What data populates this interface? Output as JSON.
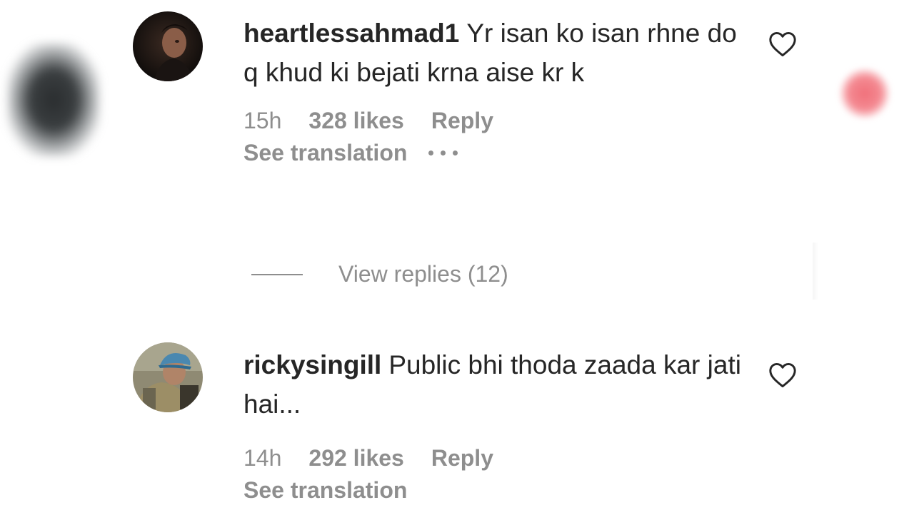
{
  "comments": [
    {
      "username": "heartlessahmad1",
      "text": "Yr isan ko isan rhne do q khud ki bejati krna aise kr k",
      "time": "15h",
      "likes": "328 likes",
      "reply_label": "Reply",
      "see_translation": "See translation",
      "avatar_icon": "profile-photo-dark",
      "like_icon": "heart-outline-icon"
    },
    {
      "username": "rickysingill",
      "text": "Public bhi thoda zaada kar jati hai...",
      "time": "14h",
      "likes": "292 likes",
      "reply_label": "Reply",
      "see_translation": "See translation",
      "avatar_icon": "profile-photo-cap",
      "like_icon": "heart-outline-icon"
    }
  ],
  "view_replies": "View replies (12)",
  "colors": {
    "text": "#262626",
    "secondary": "#8e8e8e",
    "background": "#ffffff"
  }
}
